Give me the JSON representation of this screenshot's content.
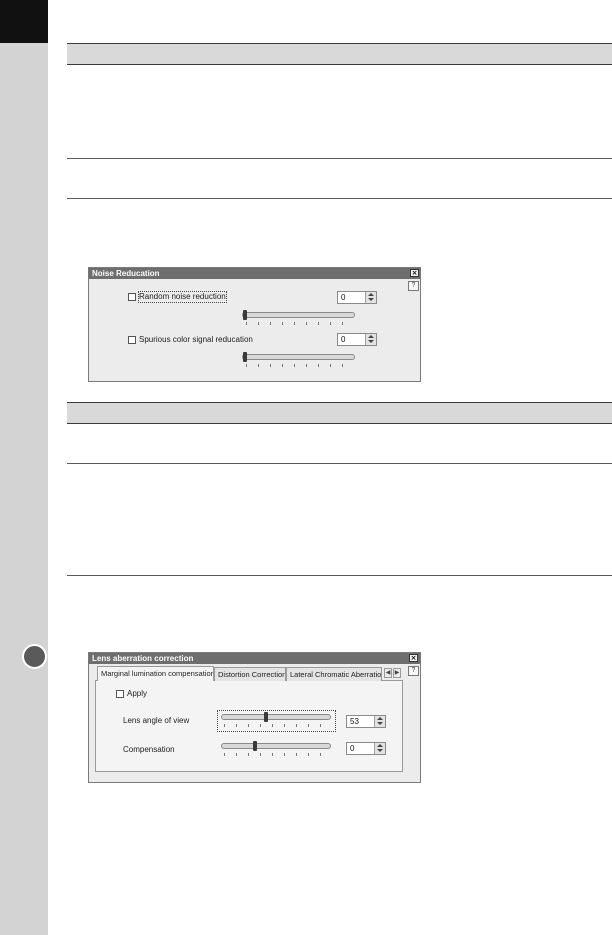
{
  "noise_reduction": {
    "title": "Noise Reducation",
    "random_noise": {
      "label": "Random noise reduction",
      "checked": false,
      "value": "0",
      "level": 0
    },
    "spurious_color": {
      "label": "Spurious color signal reducation",
      "checked": false,
      "value": "0",
      "level": 0
    }
  },
  "lens_aberration": {
    "title": "Lens aberration correction",
    "tabs": [
      {
        "label": "Marginal lumination compensation",
        "active": true
      },
      {
        "label": "Distortion Correction",
        "active": false
      },
      {
        "label": "Lateral Chromatic Aberration",
        "active": false
      }
    ],
    "apply": {
      "label": "Apply",
      "checked": false
    },
    "lens_angle": {
      "label": "Lens angle of view",
      "value": "53",
      "level": 0.4
    },
    "compensation": {
      "label": "Compensation",
      "value": "0",
      "level": 0.3
    }
  },
  "colors": {
    "sidebar": "#d3d3d3",
    "sidebar_top": "#111111",
    "titlebar": "#6e6e6e",
    "window_bg": "#ececec"
  },
  "icons": [
    "close-icon",
    "help-icon",
    "tab-left-arrow-icon",
    "tab-right-arrow-icon",
    "spin-up-icon",
    "spin-down-icon"
  ]
}
